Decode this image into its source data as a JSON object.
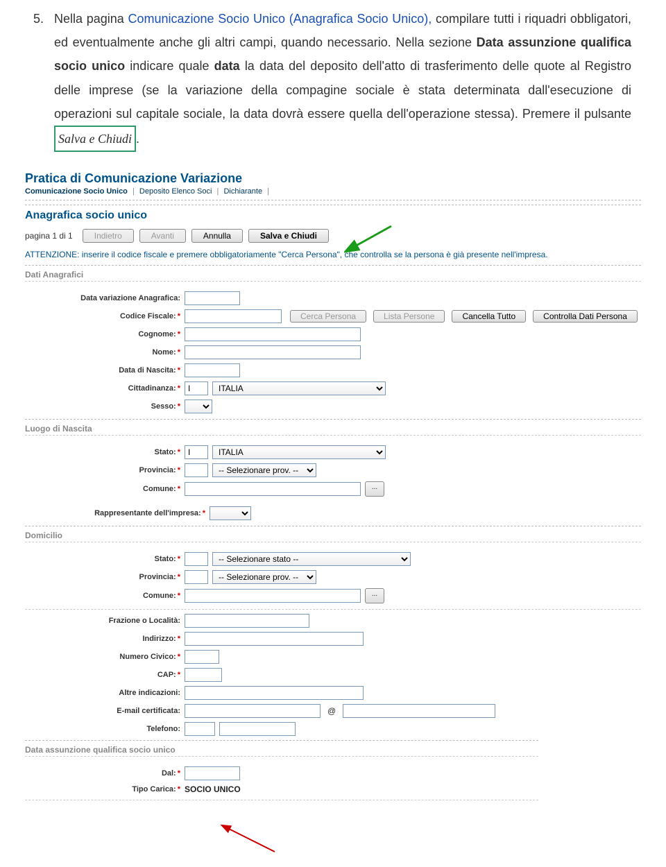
{
  "instruction": {
    "number": "5.",
    "pre": "Nella pagina ",
    "link": "Comunicazione Socio Unico (Anagrafica Socio Unico),",
    "mid1": " compilare tutti i riquadri obbligatori, ed eventualmente anche gli altri campi, quando necessario. Nella sezione ",
    "bold1": "Data assunzione qualifica socio unico",
    "mid2": " indicare quale ",
    "bold2": "data",
    "mid3": " la data del deposito dell'atto di trasferimento delle quote al Registro delle imprese (se la variazione della compagine sociale è stata determinata dall'esecuzione di operazioni sul capitale sociale, la data dovrà essere quella dell'operazione stessa). Premere il pulsante ",
    "salva": "Salva e Chiudi",
    "post": "."
  },
  "app": {
    "title": "Pratica di Comunicazione Variazione",
    "tabs": {
      "t1": "Comunicazione Socio Unico",
      "t2": "Deposito Elenco Soci",
      "t3": "Dichiarante"
    },
    "section": "Anagrafica socio unico",
    "pager": "pagina 1 di 1",
    "buttons": {
      "back": "Indietro",
      "fwd": "Avanti",
      "cancel": "Annulla",
      "save": "Salva e Chiudi"
    },
    "notice": "ATTENZIONE: inserire il codice fiscale e premere obbligatoriamente \"Cerca Persona\", che controlla se la persona è già presente nell'impresa."
  },
  "groups": {
    "anagr": "Dati Anagrafici",
    "birth": "Luogo di Nascita",
    "dom": "Domicilio",
    "qual": "Data assunzione qualifica socio unico"
  },
  "labels": {
    "dataVar": "Data variazione Anagrafica:",
    "cf": "Codice Fiscale:",
    "cognome": "Cognome:",
    "nome": "Nome:",
    "dob": "Data di Nascita:",
    "citt": "Cittadinanza:",
    "sesso": "Sesso:",
    "stato": "Stato:",
    "prov": "Provincia:",
    "comune": "Comune:",
    "rappr": "Rappresentante dell'impresa:",
    "fraz": "Frazione o Località:",
    "indir": "Indirizzo:",
    "civico": "Numero Civico:",
    "cap": "CAP:",
    "altre": "Altre indicazioni:",
    "pec": "E-mail certificata:",
    "tel": "Telefono:",
    "dal": "Dal:",
    "tipoCarica": "Tipo Carica:"
  },
  "cfButtons": {
    "search": "Cerca Persona",
    "list": "Lista Persone",
    "clear": "Cancella Tutto",
    "check": "Controlla Dati Persona"
  },
  "values": {
    "cittCode": "I",
    "cittCountry": "ITALIA",
    "birthStateCode": "I",
    "birthStateCountry": "ITALIA",
    "provPlaceholder": "-- Selezionare prov. --",
    "statoPlaceholder": "-- Selezionare stato --",
    "tipoCaricaVal": "SOCIO UNICO",
    "dots": "..."
  }
}
